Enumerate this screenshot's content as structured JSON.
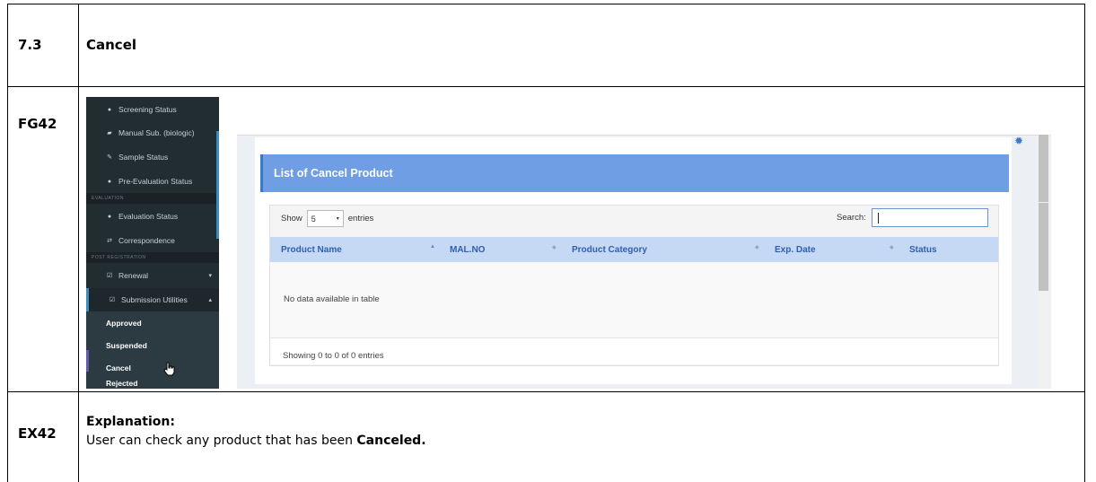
{
  "document": {
    "row1": {
      "id": "7.3",
      "title": "Cancel"
    },
    "row2": {
      "id": "FG42"
    },
    "row3": {
      "id": "EX42",
      "heading": "Explanation:",
      "text_prefix": "User can check any product that has been ",
      "text_bold": "Canceled."
    }
  },
  "sidebar": {
    "items": [
      {
        "label": "Screening Status",
        "icon": "info-circle-icon",
        "glyph": "●"
      },
      {
        "label": "Manual Sub. (biologic)",
        "icon": "file-icon",
        "glyph": "▰"
      },
      {
        "label": "Sample Status",
        "icon": "pen-icon",
        "glyph": "✎"
      },
      {
        "label": "Pre-Evaluation Status",
        "icon": "info-circle-icon",
        "glyph": "●"
      }
    ],
    "section_evaluation": "EVALUATION",
    "eval_items": [
      {
        "label": "Evaluation Status",
        "icon": "info-circle-icon",
        "glyph": "●"
      },
      {
        "label": "Correspondence",
        "icon": "exchange-icon",
        "glyph": "⇄"
      }
    ],
    "section_post": "POST REGISTRATION",
    "post_items": [
      {
        "label": "Renewal",
        "icon": "check-square-icon",
        "glyph": "☑",
        "chevron": "▾"
      },
      {
        "label": "Submission Utilities",
        "icon": "check-square-icon",
        "glyph": "☑",
        "chevron": "▴"
      }
    ],
    "sub_items": [
      "Approved",
      "Suspended",
      "Cancel",
      "Rejected"
    ]
  },
  "panel": {
    "title": "List of Cancel Product",
    "show_label": "Show",
    "entries_value": "5",
    "entries_label": "entries",
    "search_label": "Search:",
    "search_value": "",
    "columns": [
      "Product Name",
      "MAL.NO",
      "Product Category",
      "Exp. Date",
      "Status"
    ],
    "empty_message": "No data available in table",
    "footer": "Showing 0 to 0 of 0 entries"
  },
  "colors": {
    "sidebar_bg": "#222d32",
    "header_blue": "#6f9ee4",
    "table_head": "#c6d9f4",
    "column_text": "#2f5fb0"
  }
}
